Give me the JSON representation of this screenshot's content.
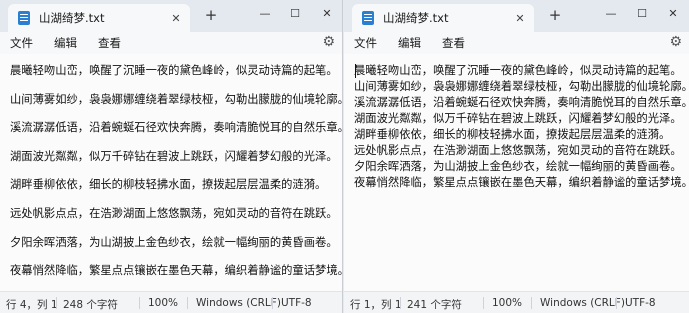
{
  "tab": {
    "title": "山湖绮梦.txt",
    "close": "✕",
    "new_tab": "+"
  },
  "window_controls": {
    "minimize": "—",
    "maximize": "☐",
    "close": "✕"
  },
  "menu": {
    "file": "文件",
    "edit": "编辑",
    "view": "查看"
  },
  "left_window": {
    "lines": [
      "晨曦轻吻山峦，唤醒了沉睡一夜的黛色峰岭，似灵动诗篇的起笔。",
      "山间薄雾如纱，袅袅娜娜缠绕着翠绿枝桠，勾勒出朦胧的仙境轮廓。",
      "溪流潺潺低语，沿着蜿蜒石径欢快奔腾，奏响清脆悦耳的自然乐章。",
      "湖面波光粼粼，似万千碎钻在碧波上跳跃，闪耀着梦幻般的光泽。",
      "湖畔垂柳依依，细长的柳枝轻拂水面，撩拨起层层温柔的涟漪。",
      "远处帆影点点，在浩渺湖面上悠悠飘荡，宛如灵动的音符在跳跃。",
      "夕阳余晖洒落，为山湖披上金色纱衣，绘就一幅绚丽的黄昏画卷。",
      "夜幕悄然降临，繁星点点镶嵌在墨色天幕，编织着静谧的童话梦境。"
    ],
    "status": {
      "position": "行 4，列 1",
      "chars": "248 个字符",
      "zoom": "100%",
      "eol": "Windows (CRLF)",
      "encoding": "UTF-8"
    }
  },
  "right_window": {
    "lines": [
      "晨曦轻吻山峦，唤醒了沉睡一夜的黛色峰岭，似灵动诗篇的起笔。",
      "山间薄雾如纱，袅袅娜娜缠绕着翠绿枝桠，勾勒出朦胧的仙境轮廓。",
      "溪流潺潺低语，沿着蜿蜒石径欢快奔腾，奏响清脆悦耳的自然乐章。",
      "湖面波光粼粼，似万千碎钻在碧波上跳跃，闪耀着梦幻般的光泽。",
      "湖畔垂柳依依，细长的柳枝轻拂水面，撩拨起层层温柔的涟漪。",
      "远处帆影点点，在浩渺湖面上悠悠飘荡，宛如灵动的音符在跳跃。",
      "夕阳余晖洒落，为山湖披上金色纱衣，绘就一幅绚丽的黄昏画卷。",
      "夜幕悄然降临，繁星点点镶嵌在墨色天幕，编织着静谧的童话梦境。"
    ],
    "status": {
      "position": "行 1，列 1",
      "chars": "241 个字符",
      "zoom": "100%",
      "eol": "Windows (CRLF)",
      "encoding": "UTF-8"
    }
  },
  "icons": {
    "file": "notepad-file-icon",
    "settings": "gear-icon"
  }
}
